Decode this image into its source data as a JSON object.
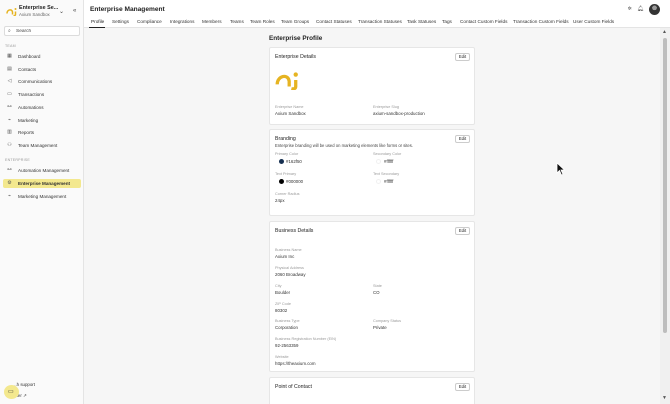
{
  "sidebar": {
    "enterprise_name": "Enterprise Se...",
    "enterprise_sub": "Axium Sandbox",
    "search_placeholder": "Search",
    "section_team": "TEAM",
    "section_enterprise": "ENTERPRISE",
    "items": [
      {
        "label": "Dashboard",
        "icon": "grid-icon"
      },
      {
        "label": "Contacts",
        "icon": "contacts-icon"
      },
      {
        "label": "Communications",
        "icon": "megaphone-icon"
      },
      {
        "label": "Transactions",
        "icon": "transactions-icon"
      },
      {
        "label": "Automations",
        "icon": "automation-icon"
      },
      {
        "label": "Marketing",
        "icon": "marketing-icon"
      },
      {
        "label": "Reports",
        "icon": "reports-icon"
      },
      {
        "label": "Team Management",
        "icon": "team-icon"
      }
    ],
    "enterprise_items": [
      {
        "label": "Automation Management",
        "icon": "automation-icon"
      },
      {
        "label": "Enterprise Management",
        "icon": "gear-icon",
        "active": true
      },
      {
        "label": "Marketing Management",
        "icon": "marketing-icon"
      }
    ],
    "footer_support": "...h support",
    "footer_link": "...ter"
  },
  "header": {
    "title": "Enterprise Management",
    "tabs": [
      "Profile",
      "Settings",
      "Compliance",
      "Integrations",
      "Members",
      "Teams",
      "Team Roles",
      "Team Groups",
      "Contact Statuses",
      "Transaction Statuses",
      "Task Statuses",
      "Tags",
      "Contact Custom Fields",
      "Transaction Custom Fields",
      "User Custom Fields"
    ],
    "active_tab": "Profile"
  },
  "profile": {
    "heading": "Enterprise Profile",
    "edit_label": "Edit",
    "details": {
      "title": "Enterprise Details",
      "name_label": "Enterprise Name",
      "name_value": "Axium Sandbox",
      "slug_label": "Enterprise Slug",
      "slug_value": "axium-sandbox-production"
    },
    "branding": {
      "title": "Branding",
      "description": "Enterprise branding will be used on marketing elements like forms or sites.",
      "primary_label": "Primary Color",
      "primary_value": "#162f50",
      "secondary_label": "Secondary Color",
      "secondary_value": "#ffffff",
      "text_primary_label": "Text Primary",
      "text_primary_value": "#000000",
      "text_secondary_label": "Text Secondary",
      "text_secondary_value": "#ffffff",
      "radius_label": "Corner Radius",
      "radius_value": "24px"
    },
    "business": {
      "title": "Business Details",
      "business_name_label": "Business Name",
      "business_name_value": "Axium Inc",
      "address_label": "Physical Address",
      "address_value": "2060 Broadway",
      "city_label": "City",
      "city_value": "Boulder",
      "state_label": "State",
      "state_value": "CO",
      "zip_label": "ZIP Code",
      "zip_value": "80302",
      "type_label": "Business Type",
      "type_value": "Corporation",
      "status_label": "Company Status",
      "status_value": "Private",
      "ein_label": "Business Registration Number (EIN)",
      "ein_value": "92-2563359",
      "website_label": "Website",
      "website_value": "https://theaxium.com"
    },
    "contact": {
      "title": "Point of Contact"
    }
  },
  "colors": {
    "accent": "#f3e88e",
    "brand_primary": "#162f50",
    "logo": "#e6b422"
  }
}
